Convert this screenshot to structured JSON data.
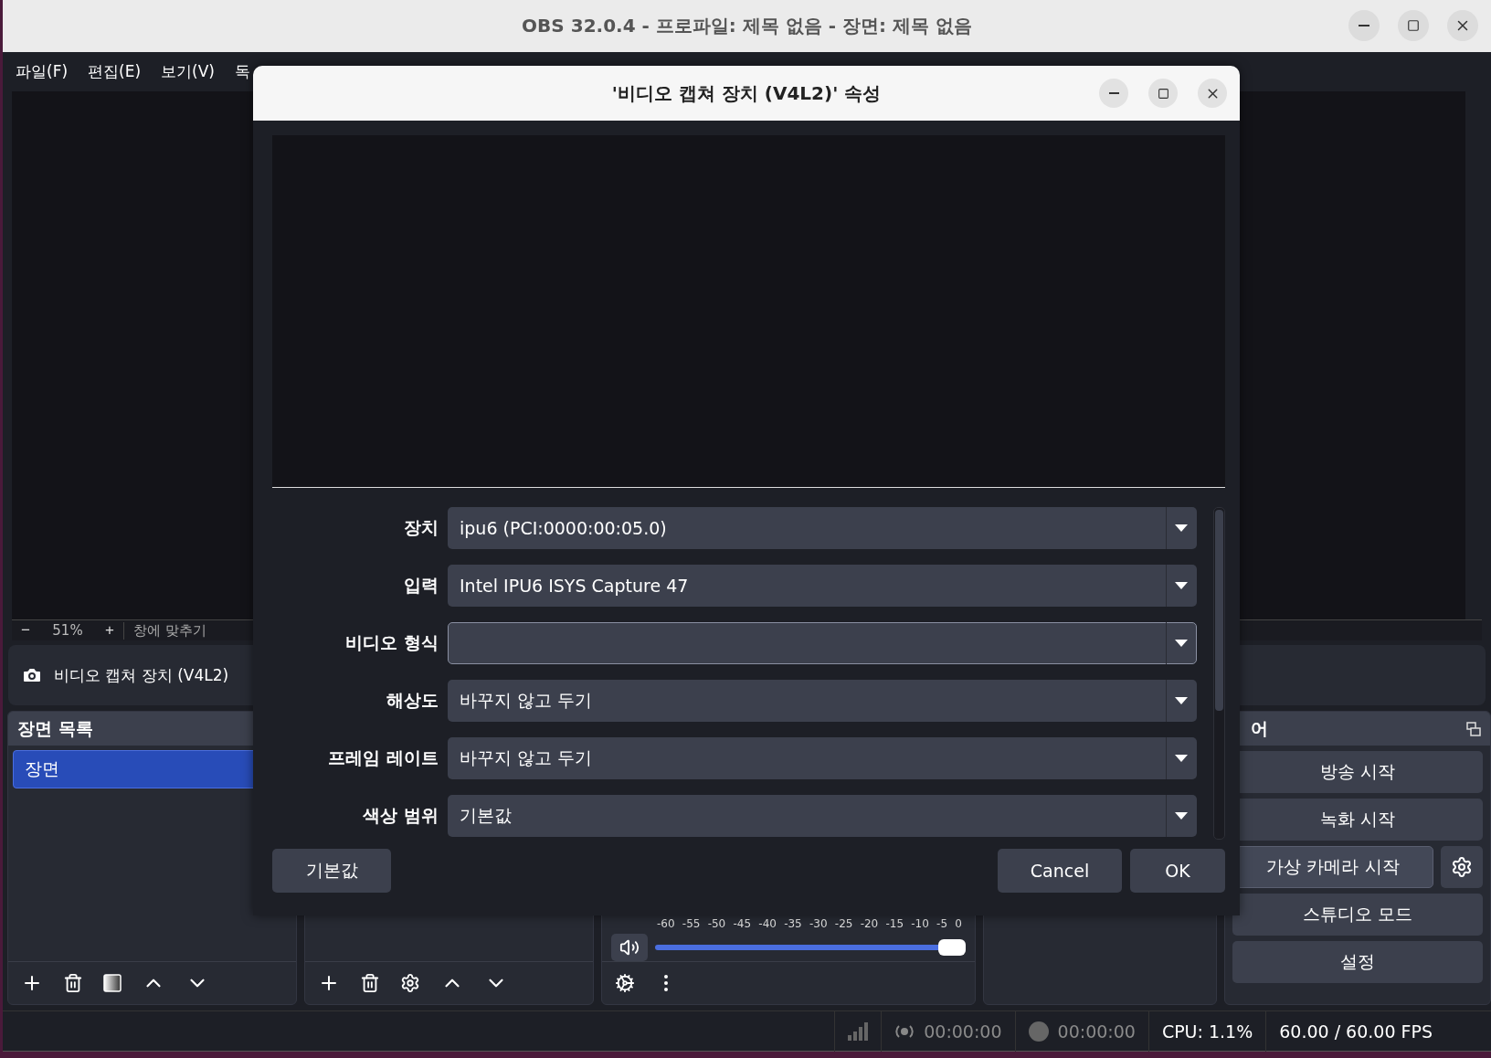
{
  "window": {
    "title": "OBS 32.0.4 - 프로파일: 제목 없음 - 장면: 제목 없음"
  },
  "menu": [
    {
      "label": "파일(F)"
    },
    {
      "label": "편집(E)"
    },
    {
      "label": "보기(V)"
    },
    {
      "label": "독"
    }
  ],
  "zoom_bar": {
    "minus": "−",
    "percent": "51%",
    "plus": "+",
    "fit": "창에 맞추기"
  },
  "source_toolbar": {
    "source_name": "비디오 캡쳐 장치 (V4L2)"
  },
  "scenes": {
    "title": "장면 목록",
    "items": [
      {
        "label": "장면",
        "selected": true
      }
    ]
  },
  "mixer": {
    "scale": [
      "-60",
      "-55",
      "-50",
      "-45",
      "-40",
      "-35",
      "-30",
      "-25",
      "-20",
      "-15",
      "-10",
      "-5",
      "0"
    ],
    "volume": {
      "level": 1
    }
  },
  "controls": {
    "title": "어",
    "buttons": [
      {
        "label": "방송 시작",
        "kind": "plain"
      },
      {
        "label": "녹화 시작",
        "kind": "plain"
      },
      {
        "label": "가상 카메라 시작",
        "kind": "with_settings"
      },
      {
        "label": "스튜디오 모드",
        "kind": "plain"
      },
      {
        "label": "설정",
        "kind": "plain"
      }
    ]
  },
  "status_bar": {
    "stream_time": "00:00:00",
    "record_time": "00:00:00",
    "cpu": "CPU: 1.1%",
    "fps": "60.00 / 60.00 FPS"
  },
  "dialog": {
    "title": "'비디오 캡쳐 장치 (V4L2)' 속성",
    "fields": [
      {
        "label": "장치",
        "value": "ipu6 (PCI:0000:00:05.0)",
        "focused": false
      },
      {
        "label": "입력",
        "value": "Intel IPU6 ISYS Capture 47",
        "focused": false
      },
      {
        "label": "비디오 형식",
        "focused": true
      },
      {
        "label": "해상도",
        "value": "바꾸지 않고 두기",
        "focused": false
      },
      {
        "label": "프레임 레이트",
        "value": "바꾸지 않고 두기",
        "focused": false
      },
      {
        "label": "색상 범위",
        "value": "기본값",
        "focused": false
      }
    ],
    "buttons": {
      "defaults": "기본값",
      "cancel": "Cancel",
      "ok": "OK"
    }
  }
}
